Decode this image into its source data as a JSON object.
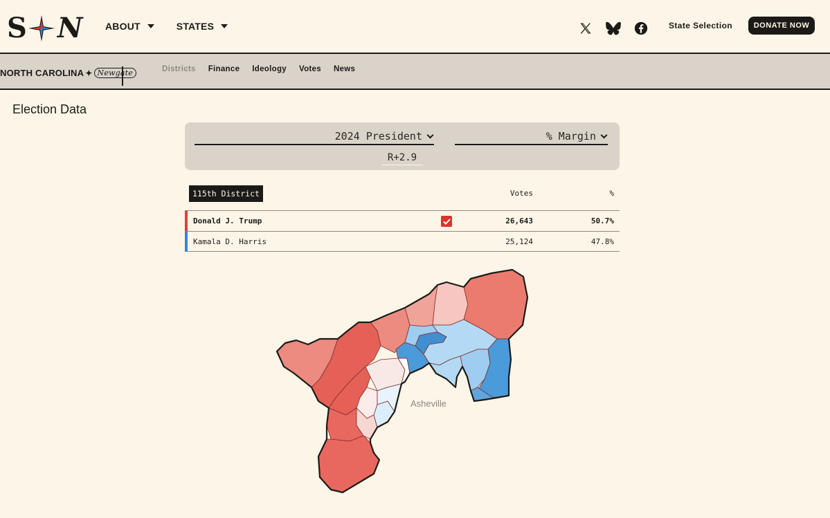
{
  "header": {
    "logo_left": "S",
    "logo_right": "N",
    "nav": [
      {
        "label": "ABOUT"
      },
      {
        "label": "STATES"
      }
    ],
    "state_selection": "State Selection",
    "donate": "DONATE NOW"
  },
  "subheader": {
    "state": "NORTH CAROLINA",
    "brand_script": "Newgate",
    "tabs": [
      {
        "label": "Districts",
        "active": true
      },
      {
        "label": "Finance"
      },
      {
        "label": "Ideology"
      },
      {
        "label": "Votes"
      },
      {
        "label": "News"
      }
    ]
  },
  "page_title": "Election Data",
  "selectors": {
    "race": "2024 President",
    "metric": "% Margin",
    "margin": "R+2.9"
  },
  "results": {
    "district": "115th District",
    "col_votes": "Votes",
    "col_pct": "%",
    "rows": [
      {
        "name": "Donald J. Trump",
        "votes": "26,643",
        "pct": "50.7%",
        "winner": true,
        "color": "#e0403a"
      },
      {
        "name": "Kamala D. Harris",
        "votes": "25,124",
        "pct": "47.8%",
        "winner": false,
        "color": "#3b82d6"
      }
    ]
  },
  "map": {
    "city_label": "Asheville"
  },
  "colors": {
    "background": "#fdf6e8",
    "nav_bar": "#d9d3ca",
    "ink": "#1c1a18",
    "republican": "#e0403a",
    "democrat": "#3b82d6"
  }
}
